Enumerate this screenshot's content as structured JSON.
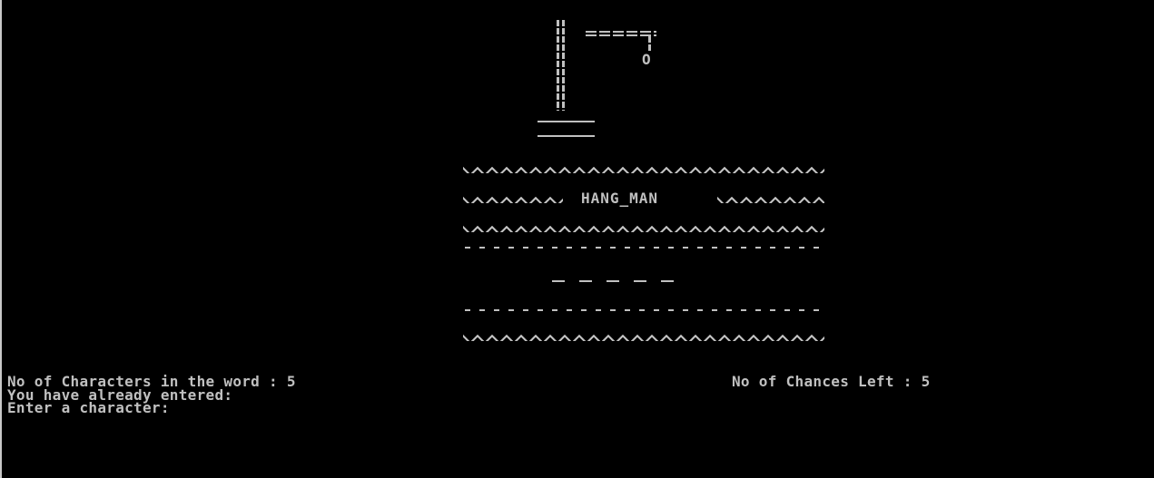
{
  "game": {
    "title": "HANG_MAN",
    "title_border": "*******",
    "hangman_head": "O",
    "word_length": 5,
    "blanks_text": "_ _ _ _ _"
  },
  "status": {
    "characters_label": "No of Characters in the word : 5",
    "chances_label": "No of Chances Left : 5",
    "entered_label": "You have already entered:",
    "prompt_label": "Enter a character:"
  },
  "colors": {
    "background": "#000000",
    "text": "#c0c0c0"
  }
}
